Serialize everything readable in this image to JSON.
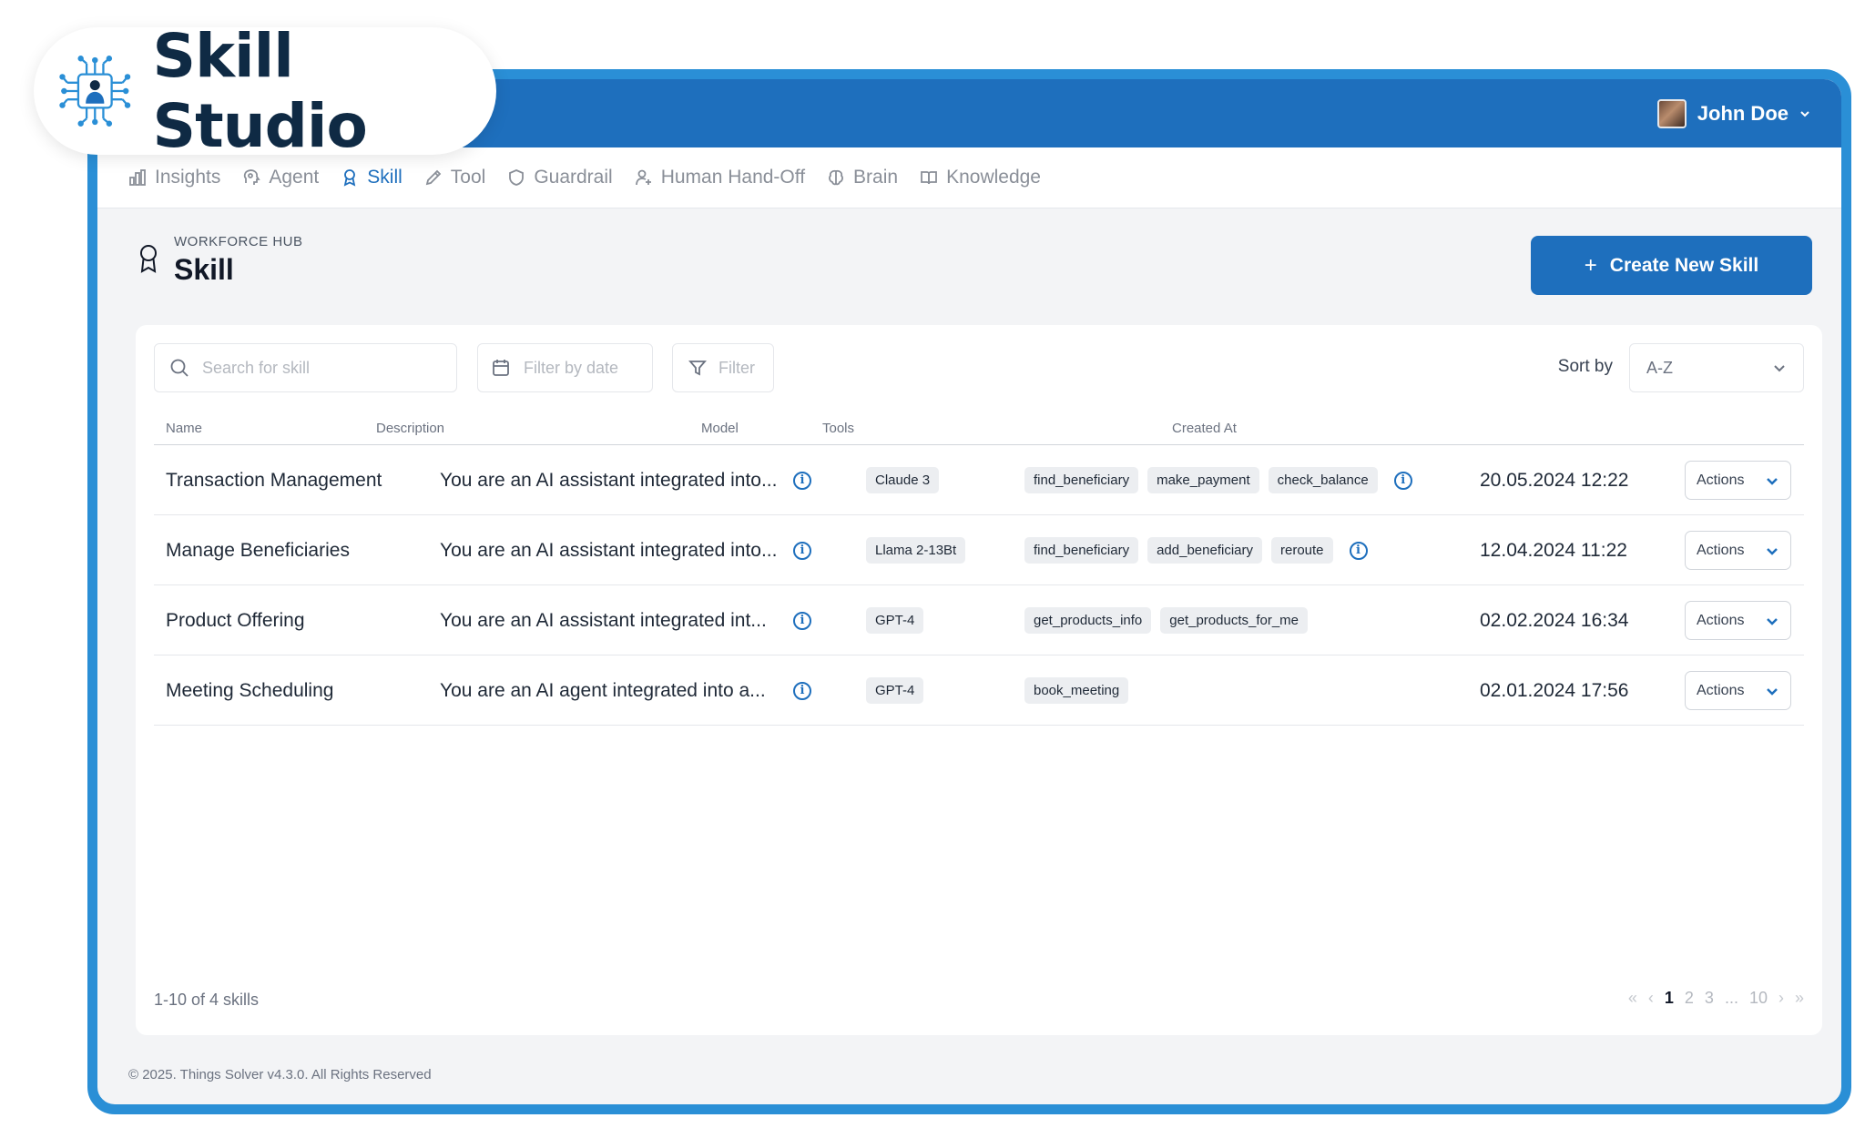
{
  "brand": {
    "name": "Skill Studio",
    "logo_icon": "chip-person-icon"
  },
  "user": {
    "name": "John Doe"
  },
  "nav": [
    {
      "label": "Insights",
      "icon": "bar-chart-icon",
      "active": false
    },
    {
      "label": "Agent",
      "icon": "brain-head-icon",
      "active": false
    },
    {
      "label": "Skill",
      "icon": "award-icon",
      "active": true
    },
    {
      "label": "Tool",
      "icon": "pencil-icon",
      "active": false
    },
    {
      "label": "Guardrail",
      "icon": "shield-icon",
      "active": false
    },
    {
      "label": "Human Hand-Off",
      "icon": "user-plus-icon",
      "active": false
    },
    {
      "label": "Brain",
      "icon": "brain-icon",
      "active": false
    },
    {
      "label": "Knowledge",
      "icon": "book-icon",
      "active": false
    }
  ],
  "header": {
    "hub": "WORKFORCE HUB",
    "title": "Skill",
    "create_label": "Create New Skill"
  },
  "toolbar": {
    "search_placeholder": "Search for skill",
    "date_placeholder": "Filter by date",
    "filter_label": "Filter",
    "sort_label": "Sort by",
    "sort_value": "A-Z"
  },
  "table": {
    "columns": [
      "Name",
      "Description",
      "Model",
      "Tools",
      "Created At"
    ],
    "rows": [
      {
        "name": "Transaction Management",
        "description": "You are an AI assistant integrated into...",
        "model": "Claude 3",
        "tools": [
          "find_beneficiary",
          "make_payment",
          "check_balance"
        ],
        "tools_info": true,
        "created": "20.05.2024 12:22",
        "actions": "Actions"
      },
      {
        "name": "Manage Beneficiaries",
        "description": "You are an AI assistant integrated into...",
        "model": "Llama 2-13Bt",
        "tools": [
          "find_beneficiary",
          "add_beneficiary",
          "reroute"
        ],
        "tools_info": true,
        "created": "12.04.2024 11:22",
        "actions": "Actions"
      },
      {
        "name": "Product Offering",
        "description": "You are an AI assistant integrated int...",
        "model": "GPT-4",
        "tools": [
          "get_products_info",
          "get_products_for_me"
        ],
        "tools_info": false,
        "created": "02.02.2024 16:34",
        "actions": "Actions"
      },
      {
        "name": "Meeting Scheduling",
        "description": "You are an AI agent integrated into a...",
        "model": "GPT-4",
        "tools": [
          "book_meeting"
        ],
        "tools_info": false,
        "created": "02.01.2024 17:56",
        "actions": "Actions"
      }
    ]
  },
  "footer": {
    "count": "1-10 of 4 skills",
    "pages": [
      "1",
      "2",
      "3",
      "...",
      "10"
    ],
    "current_page": "1",
    "copyright": "© 2025. Things Solver v4.3.0. All Rights Reserved"
  },
  "colors": {
    "primary": "#1e6fbd",
    "frame": "#2a8fd6",
    "brand_text": "#0f2a44"
  }
}
